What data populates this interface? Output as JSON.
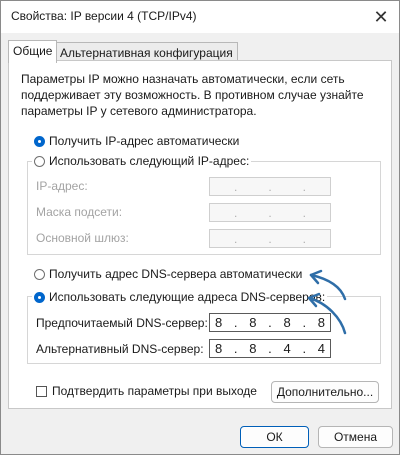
{
  "window": {
    "title": "Свойства: IP версии 4 (TCP/IPv4)",
    "close_icon": "close-icon"
  },
  "tabs": [
    {
      "label": "Общие",
      "active": true
    },
    {
      "label": "Альтернативная конфигурация",
      "active": false
    }
  ],
  "description": "Параметры IP можно назначать автоматически, если сеть поддерживает эту возможность. В противном случае узнайте параметры IP у сетевого администратора.",
  "ip_section": {
    "auto_label": "Получить IP-адрес автоматически",
    "auto_checked": true,
    "manual_label": "Использовать следующий IP-адрес:",
    "manual_checked": false,
    "fields": [
      {
        "label": "IP-адрес:",
        "octets": [
          "",
          "",
          "",
          ""
        ]
      },
      {
        "label": "Маска подсети:",
        "octets": [
          "",
          "",
          "",
          ""
        ]
      },
      {
        "label": "Основной шлюз:",
        "octets": [
          "",
          "",
          "",
          ""
        ]
      }
    ],
    "separator": "."
  },
  "dns_section": {
    "auto_label": "Получить адрес DNS-сервера автоматически",
    "auto_checked": false,
    "manual_label": "Использовать следующие адреса DNS-серверов:",
    "manual_checked": true,
    "fields": [
      {
        "label": "Предпочитаемый DNS-сервер:",
        "octets": [
          "8",
          "8",
          "8",
          "8"
        ]
      },
      {
        "label": "Альтернативный DNS-сервер:",
        "octets": [
          "8",
          "8",
          "4",
          "4"
        ]
      }
    ],
    "separator": "."
  },
  "validate": {
    "label": "Подтвердить параметры при выходе",
    "checked": false
  },
  "buttons": {
    "advanced": "Дополнительно...",
    "ok": "ОК",
    "cancel": "Отмена"
  },
  "colors": {
    "accent": "#0066cc",
    "arrow": "#2f6ea8"
  }
}
